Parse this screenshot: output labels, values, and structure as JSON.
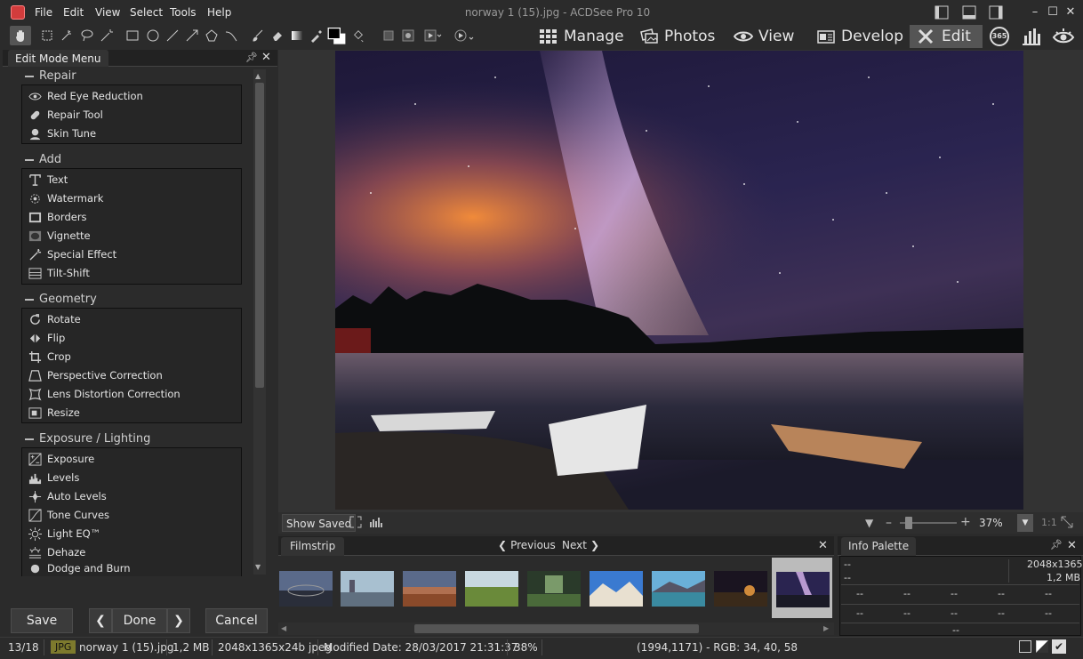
{
  "window": {
    "title": "norway 1 (15).jpg - ACDSee Pro 10",
    "controls": [
      "restore-left",
      "restore-bottom",
      "restore-right",
      "minimize",
      "maximize",
      "close"
    ]
  },
  "menu": [
    "File",
    "Edit",
    "View",
    "Select",
    "Tools",
    "Help"
  ],
  "modes": [
    {
      "label": "Manage",
      "icon": "grid-icon"
    },
    {
      "label": "Photos",
      "icon": "photos-icon"
    },
    {
      "label": "View",
      "icon": "eye-icon"
    },
    {
      "label": "Develop",
      "icon": "develop-icon"
    },
    {
      "label": "Edit",
      "icon": "edit-icon",
      "active": true
    }
  ],
  "extra_modes": [
    "365",
    "dashboard",
    "eye-settings"
  ],
  "panel": {
    "title": "Edit Mode Menu",
    "groups": [
      {
        "name": "Repair",
        "items": [
          "Red Eye Reduction",
          "Repair Tool",
          "Skin Tune"
        ]
      },
      {
        "name": "Add",
        "items": [
          "Text",
          "Watermark",
          "Borders",
          "Vignette",
          "Special Effect",
          "Tilt-Shift"
        ]
      },
      {
        "name": "Geometry",
        "items": [
          "Rotate",
          "Flip",
          "Crop",
          "Perspective Correction",
          "Lens Distortion Correction",
          "Resize"
        ]
      },
      {
        "name": "Exposure / Lighting",
        "items": [
          "Exposure",
          "Levels",
          "Auto Levels",
          "Tone Curves",
          "Light EQ™",
          "Dehaze",
          "Dodge and Burn"
        ]
      }
    ]
  },
  "buttons": {
    "save": "Save",
    "done": "Done",
    "cancel": "Cancel"
  },
  "viewbar": {
    "show_saved": "Show Saved",
    "zoom": "37%",
    "ratio": "1:1"
  },
  "filmstrip": {
    "title": "Filmstrip",
    "previous": "Previous",
    "next": "Next"
  },
  "info": {
    "title": "Info Palette",
    "left1": "--",
    "right1": "2048x1365",
    "left2": "--",
    "right2": "1,2 MB",
    "cell": "--"
  },
  "status": {
    "position": "13/18",
    "format": "JPG",
    "filename": "norway 1 (15).jpg",
    "size": "1,2 MB",
    "dimensions": "2048x1365x24b jpeg",
    "modified": "Modified Date: 28/03/2017 21:31:37",
    "zoom": "38%",
    "pixel": "(1994,1171) - RGB: 34, 40, 58"
  }
}
